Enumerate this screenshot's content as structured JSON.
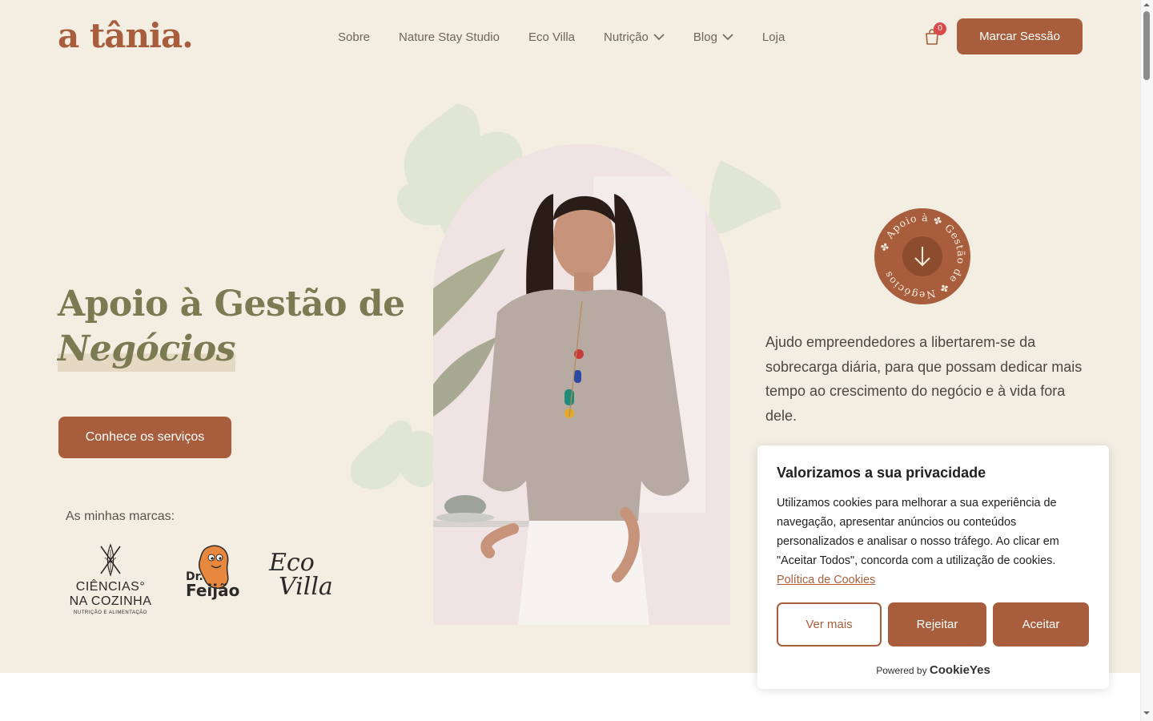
{
  "brand": {
    "logo_text": "a tânia",
    "logo_dot": "."
  },
  "nav": {
    "items": [
      {
        "label": "Sobre"
      },
      {
        "label": "Nature Stay Studio"
      },
      {
        "label": "Eco Villa"
      },
      {
        "label": "Nutrição"
      },
      {
        "label": "Blog"
      },
      {
        "label": "Loja"
      }
    ],
    "cart_count": "0",
    "cta": "Marcar Sessão"
  },
  "hero": {
    "title_line1": "Apoio à Gestão de",
    "title_line2": "Negócios",
    "cta": "Conhece os serviços",
    "brands_label": "As minhas marcas:",
    "brands": {
      "b1_title": "CIÊNCIAS°\nNA COZINHA",
      "b1_sub": "NUTRIÇÃO E ALIMENTAÇÃO",
      "b3_line1": "Eco",
      "b3_line2": "Villa"
    },
    "badge_text": "✤ Apoio à ✤ Gestão de ✤ Negócios",
    "intro": "Ajudo empreendedores a libertarem-se da sobrecarga diária, para que possam dedicar mais tempo ao crescimento do negócio e à vida fora dele."
  },
  "cookie": {
    "title": "Valorizamos a sua privacidade",
    "text": "Utilizamos cookies para melhorar a sua experiência de navegação, apresentar anúncios ou conteúdos personalizados e analisar o nosso tráfego. Ao clicar em \"Aceitar Todos\", concorda com a utilização de cookies.",
    "policy_link": "Política de Cookies",
    "btn_more": "Ver mais",
    "btn_reject": "Rejeitar",
    "btn_accept": "Aceitar",
    "powered_by": "Powered by",
    "powered_brand": "CookieYes"
  },
  "colors": {
    "accent": "#a85e3c",
    "background": "#f3ede2",
    "title": "#7b7a52"
  }
}
